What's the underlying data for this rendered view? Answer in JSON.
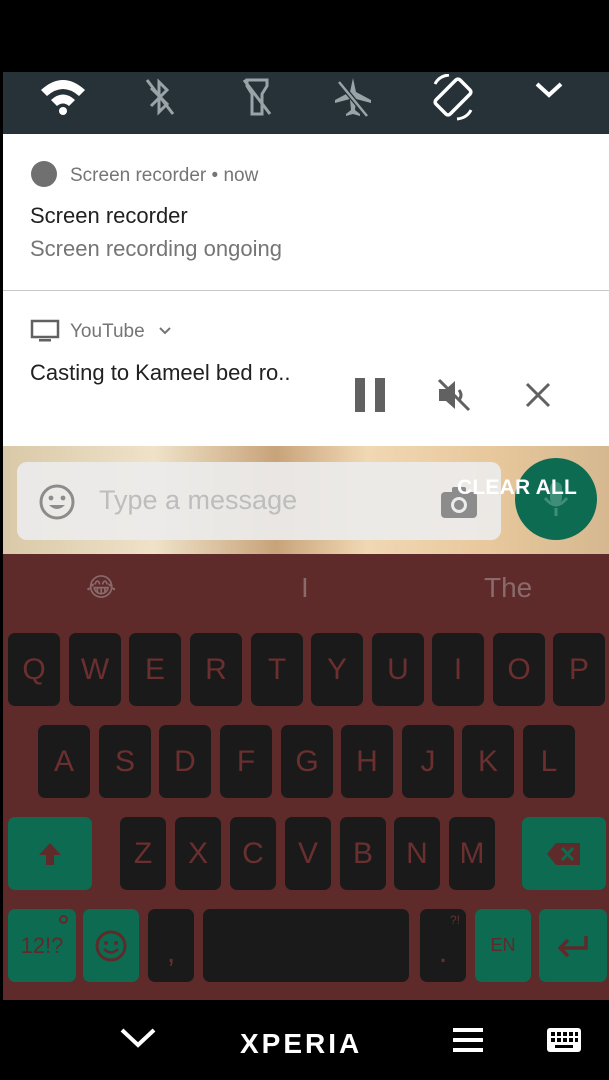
{
  "notifications": {
    "recorder": {
      "app_name": "Screen recorder",
      "time": "now",
      "title": "Screen recorder",
      "text": "Screen recording ongoing"
    },
    "youtube": {
      "app_name": "YouTube",
      "title": "Casting to Kameel bed ro.."
    },
    "clear_all": "CLEAR ALL"
  },
  "quick_settings": [
    "wifi-icon",
    "bluetooth-off-icon",
    "flashlight-off-icon",
    "airplane-mode-icon",
    "auto-rotate-icon",
    "expand-icon"
  ],
  "chat": {
    "placeholder": "Type a message"
  },
  "keyboard": {
    "suggestions": [
      "😂",
      "I",
      "The"
    ],
    "row1": [
      "Q",
      "W",
      "E",
      "R",
      "T",
      "Y",
      "U",
      "I",
      "O",
      "P"
    ],
    "row2": [
      "A",
      "S",
      "D",
      "F",
      "G",
      "H",
      "J",
      "K",
      "L"
    ],
    "row3": [
      "Z",
      "X",
      "C",
      "V",
      "B",
      "N",
      "M"
    ],
    "symbols_key": "12!?",
    "comma_key": ",",
    "period_key": ".",
    "period_sub": "?!",
    "lang_key": "EN"
  },
  "nav": {
    "brand": "XPERIA"
  },
  "colors": {
    "quick_settings_bg": "#263238",
    "keyboard_bg": "#5e2a2a",
    "accent_teal": "#0d6b52"
  }
}
